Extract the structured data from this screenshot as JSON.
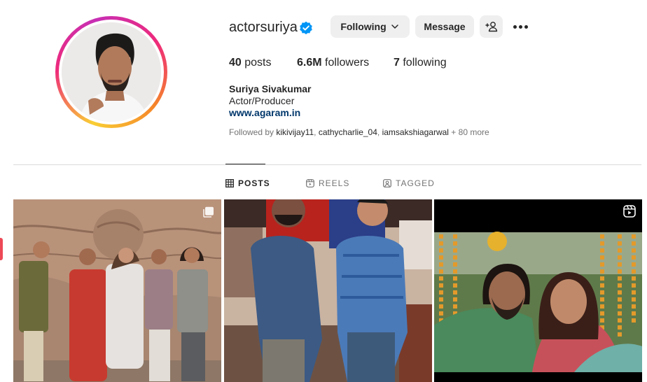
{
  "profile": {
    "username": "actorsuriya",
    "verified": true,
    "buttons": {
      "following": "Following",
      "message": "Message"
    },
    "stats": {
      "posts_count": "40",
      "posts_label": "posts",
      "followers_count": "6.6M",
      "followers_label": "followers",
      "following_count": "7",
      "following_label": "following"
    },
    "full_name": "Suriya Sivakumar",
    "category": "Actor/Producer",
    "link": "www.agaram.in",
    "followed_by": {
      "prefix": "Followed by",
      "users": [
        "kikivijay11",
        "cathycharlie_04",
        "iamsakshiagarwal"
      ],
      "more": "+ 80 more"
    }
  },
  "tabs": [
    {
      "label": "POSTS",
      "icon": "grid-icon",
      "active": true
    },
    {
      "label": "REELS",
      "icon": "reels-icon",
      "active": false
    },
    {
      "label": "TAGGED",
      "icon": "tagged-icon",
      "active": false
    }
  ],
  "posts": [
    {
      "type": "carousel",
      "icon": "multiple-posts-icon"
    },
    {
      "type": "photo"
    },
    {
      "type": "reel",
      "icon": "reel-icon"
    }
  ],
  "colors": {
    "button_bg": "#efefef",
    "verified": "#0095f6",
    "link": "#00376b",
    "muted": "#737373"
  }
}
